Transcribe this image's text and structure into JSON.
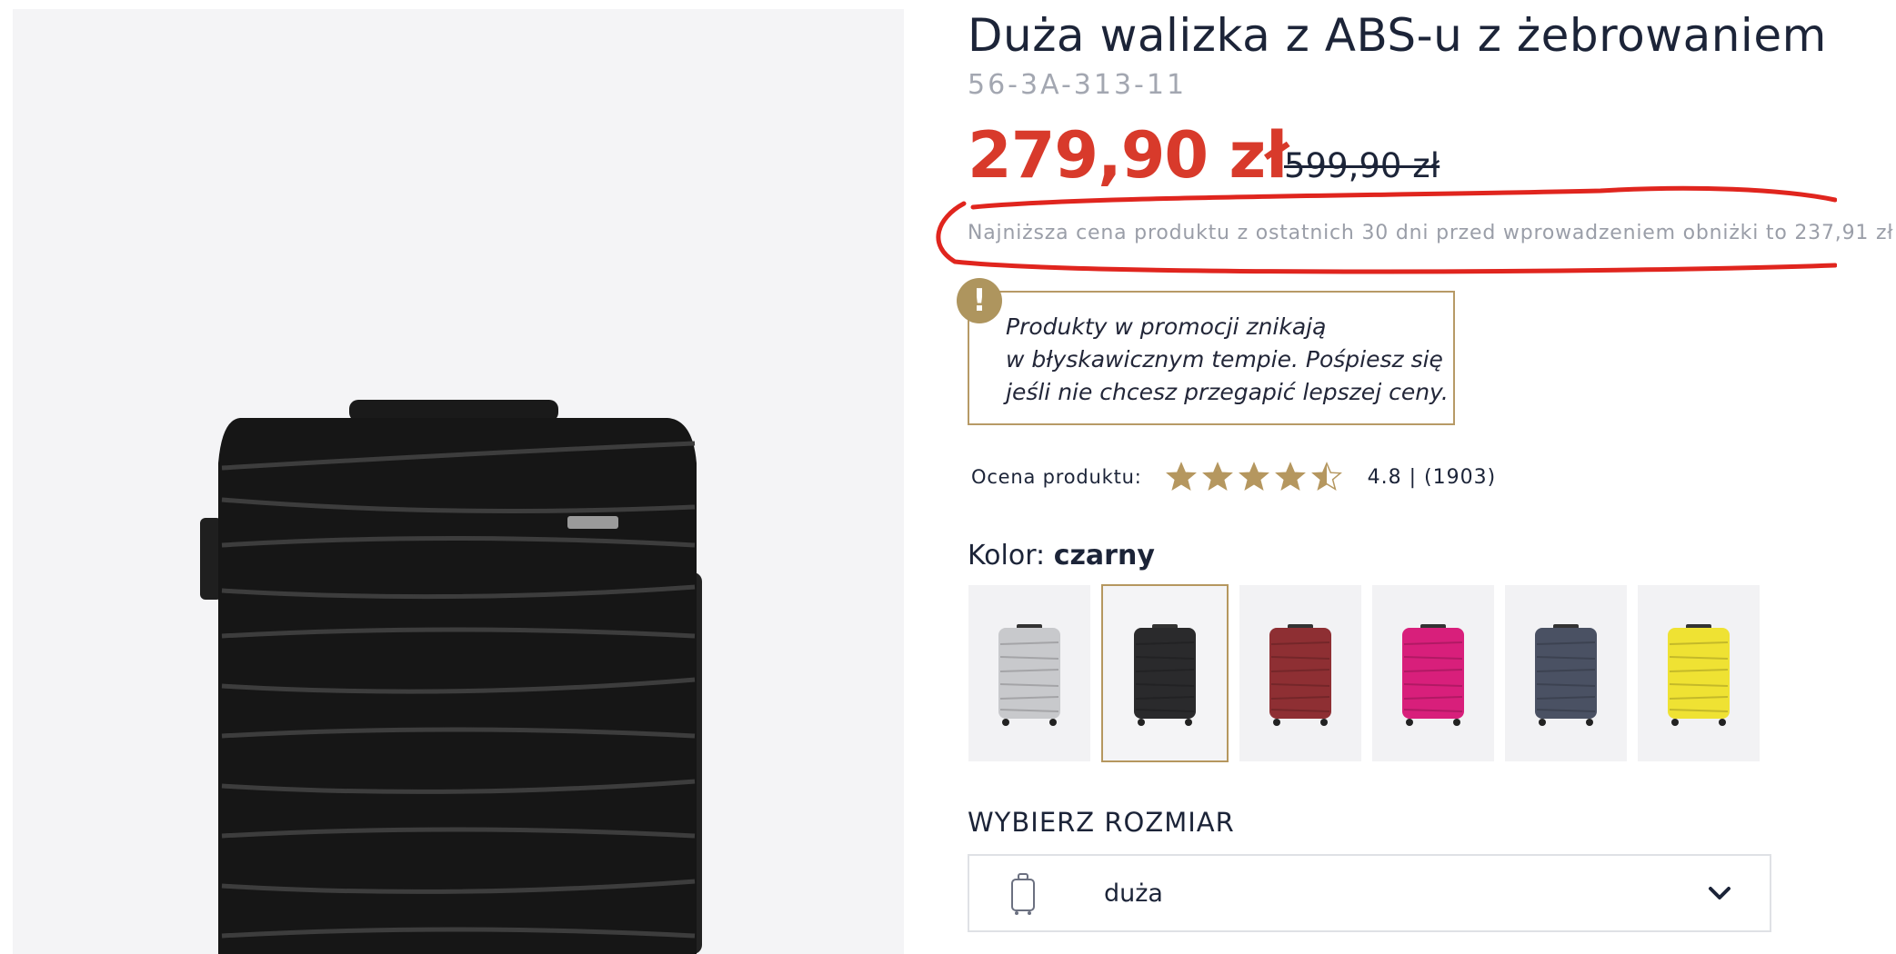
{
  "product": {
    "title": "Duża walizka z ABS-u z żebrowaniem",
    "sku": "56-3A-313-11"
  },
  "price": {
    "current": "279,90 zł",
    "old": "599,90 zł",
    "lowest_note": "Najniższa cena produktu z ostatnich 30 dni przed wprowadzeniem obniżki to 237,91 zł"
  },
  "annotation": {
    "color": "#e0251e"
  },
  "promo": {
    "badge": "!",
    "line1": "Produkty w promocji znikają",
    "line2": "w błyskawicznym tempie. Pośpiesz się",
    "line3": "jeśli nie chcesz przegapić lepszej ceny."
  },
  "rating": {
    "label": "Ocena produktu:",
    "score": 4.5,
    "max": 5,
    "value_text": "4.8 | (1903)"
  },
  "color": {
    "label": "Kolor:",
    "selected": "czarny",
    "swatches": [
      {
        "name": "silver-icon",
        "hex": "#c8c9cc",
        "selected": false
      },
      {
        "name": "black-icon",
        "hex": "#2a2a2c",
        "selected": true
      },
      {
        "name": "burgundy-icon",
        "hex": "#8e2f33",
        "selected": false
      },
      {
        "name": "pink-icon",
        "hex": "#d81f7b",
        "selected": false
      },
      {
        "name": "navy-icon",
        "hex": "#4a5163",
        "selected": false
      },
      {
        "name": "yellow-icon",
        "hex": "#efe233",
        "selected": false
      }
    ]
  },
  "size": {
    "label": "WYBIERZ ROZMIAR",
    "selected": "duża"
  },
  "colors": {
    "accent_gold": "#b5975f",
    "price_red": "#d83a2b",
    "text_dark": "#1c2438",
    "text_muted": "#9a9ea8"
  }
}
